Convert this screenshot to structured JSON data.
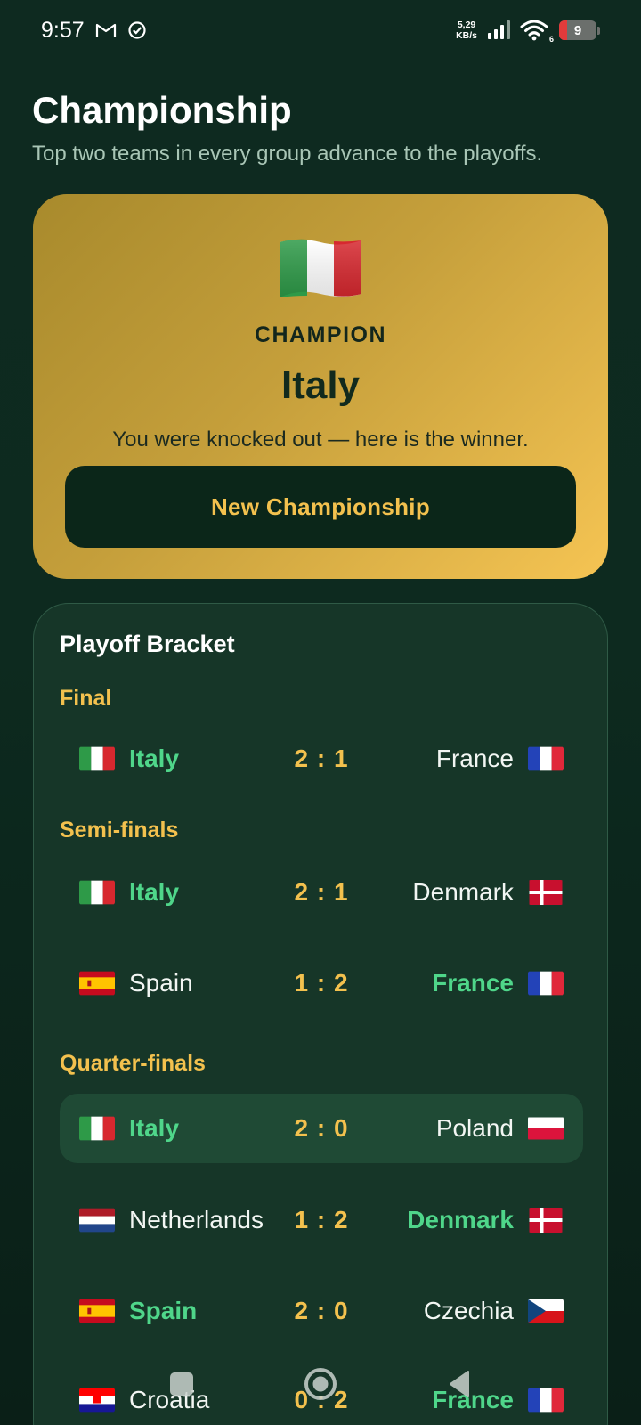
{
  "status_bar": {
    "time": "9:57",
    "net_speed_value": "5,29",
    "net_speed_unit": "KB/s",
    "wifi_label": "6",
    "battery_level": "9",
    "icons": [
      "gmail-icon",
      "check-circle-icon",
      "signal-icon",
      "wifi-icon",
      "battery-icon"
    ]
  },
  "header": {
    "title": "Championship",
    "subtitle": "Top two teams in every group advance to the playoffs."
  },
  "champion": {
    "flag": "italy-flag",
    "label": "CHAMPION",
    "name": "Italy",
    "note": "You were knocked out — here is the winner.",
    "button_label": "New Championship"
  },
  "bracket": {
    "title": "Playoff Bracket",
    "rounds": [
      {
        "label": "Final",
        "matches": [
          {
            "home": "Italy",
            "home_flag": "italy",
            "score": "2 : 1",
            "away": "France",
            "away_flag": "france",
            "winner": "home"
          }
        ]
      },
      {
        "label": "Semi-finals",
        "matches": [
          {
            "home": "Italy",
            "home_flag": "italy",
            "score": "2 : 1",
            "away": "Denmark",
            "away_flag": "denmark",
            "winner": "home"
          },
          {
            "home": "Spain",
            "home_flag": "spain",
            "score": "1 : 2",
            "away": "France",
            "away_flag": "france",
            "winner": "away"
          }
        ]
      },
      {
        "label": "Quarter-finals",
        "matches": [
          {
            "home": "Italy",
            "home_flag": "italy",
            "score": "2 : 0",
            "away": "Poland",
            "away_flag": "poland",
            "winner": "home",
            "highlighted": true
          },
          {
            "home": "Netherlands",
            "home_flag": "netherlands",
            "score": "1 : 2",
            "away": "Denmark",
            "away_flag": "denmark",
            "winner": "away"
          },
          {
            "home": "Spain",
            "home_flag": "spain",
            "score": "2 : 0",
            "away": "Czechia",
            "away_flag": "czechia",
            "winner": "home"
          },
          {
            "home": "Croatia",
            "home_flag": "croatia",
            "score": "0 : 2",
            "away": "France",
            "away_flag": "france",
            "winner": "away"
          }
        ]
      }
    ]
  },
  "nav": {
    "icons": [
      "recents-square-icon",
      "home-circle-icon",
      "back-triangle-icon"
    ]
  },
  "colors": {
    "background": "#0e2a20",
    "accent_gold": "#f3c14e",
    "winner_green": "#4fd68a",
    "card": "#163628",
    "highlight_row": "#1f4a35"
  }
}
